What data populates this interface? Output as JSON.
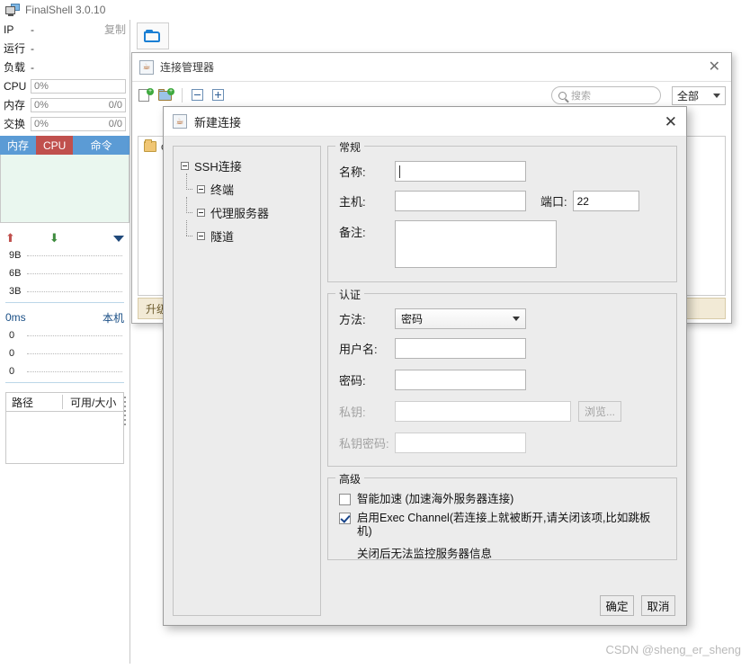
{
  "app": {
    "title": "FinalShell 3.0.10",
    "icon": "monitor-icon"
  },
  "sidebar": {
    "ip_label": "IP",
    "ip_value": "-",
    "copy_label": "复制",
    "run_label": "运行",
    "run_value": "-",
    "load_label": "负载",
    "load_value": "-",
    "cpu_label": "CPU",
    "cpu_value": "0%",
    "mem_label": "内存",
    "mem_value": "0%",
    "mem_detail": "0/0",
    "swap_label": "交换",
    "swap_value": "0%",
    "swap_detail": "0/0",
    "tabs": [
      {
        "label": "内存",
        "active": false
      },
      {
        "label": "CPU",
        "active": true
      },
      {
        "label": "命令",
        "active": false
      }
    ],
    "net_ticks": [
      "9B",
      "6B",
      "3B"
    ],
    "latency_value": "0ms",
    "latency_target": "本机",
    "latency_ticks": [
      "0",
      "0",
      "0"
    ],
    "disk_headers": [
      "路径",
      "可用/大小"
    ]
  },
  "main_toolbar": {
    "open_folder_icon": "folder-open-icon"
  },
  "connection_manager": {
    "title": "连接管理器",
    "close_label": "✕",
    "toolbar": {
      "new_connection": "new-file-icon",
      "new_folder": "new-folder-icon",
      "collapse_all": "collapse-icon",
      "expand_all": "expand-icon"
    },
    "search": {
      "placeholder": "搜索",
      "value": ""
    },
    "filter": {
      "selected": "全部"
    },
    "items": [
      {
        "label": "c"
      }
    ],
    "status_text": "升级"
  },
  "dialog": {
    "title": "新建连接",
    "close_label": "✕",
    "tree": [
      {
        "label": "SSH连接",
        "level": 0
      },
      {
        "label": "终端",
        "level": 1
      },
      {
        "label": "代理服务器",
        "level": 1
      },
      {
        "label": "隧道",
        "level": 1
      }
    ],
    "general": {
      "legend": "常规",
      "name_label": "名称:",
      "name_value": "",
      "host_label": "主机:",
      "host_value": "",
      "port_label": "端口:",
      "port_value": "22",
      "note_label": "备注:",
      "note_value": ""
    },
    "auth": {
      "legend": "认证",
      "method_label": "方法:",
      "method_value": "密码",
      "method_options": [
        "密码"
      ],
      "username_label": "用户名:",
      "username_value": "",
      "password_label": "密码:",
      "password_value": "",
      "privatekey_label": "私钥:",
      "privatekey_value": "",
      "browse_label": "浏览...",
      "keypass_label": "私钥密码:",
      "keypass_value": ""
    },
    "advanced": {
      "legend": "高级",
      "accel_label": "智能加速 (加速海外服务器连接)",
      "accel_checked": false,
      "exec_label": "启用Exec Channel(若连接上就被断开,请关闭该项,比如跳板机)",
      "exec_checked": true,
      "exec_note": "关闭后无法监控服务器信息"
    },
    "buttons": {
      "ok": "确定",
      "cancel": "取消"
    }
  },
  "watermark": "CSDN @sheng_er_sheng",
  "colors": {
    "tab_blue": "#5b9bd5",
    "tab_red": "#c0504d",
    "dialog_bg": "#ececec",
    "accent_blue": "#1a7fd4"
  }
}
